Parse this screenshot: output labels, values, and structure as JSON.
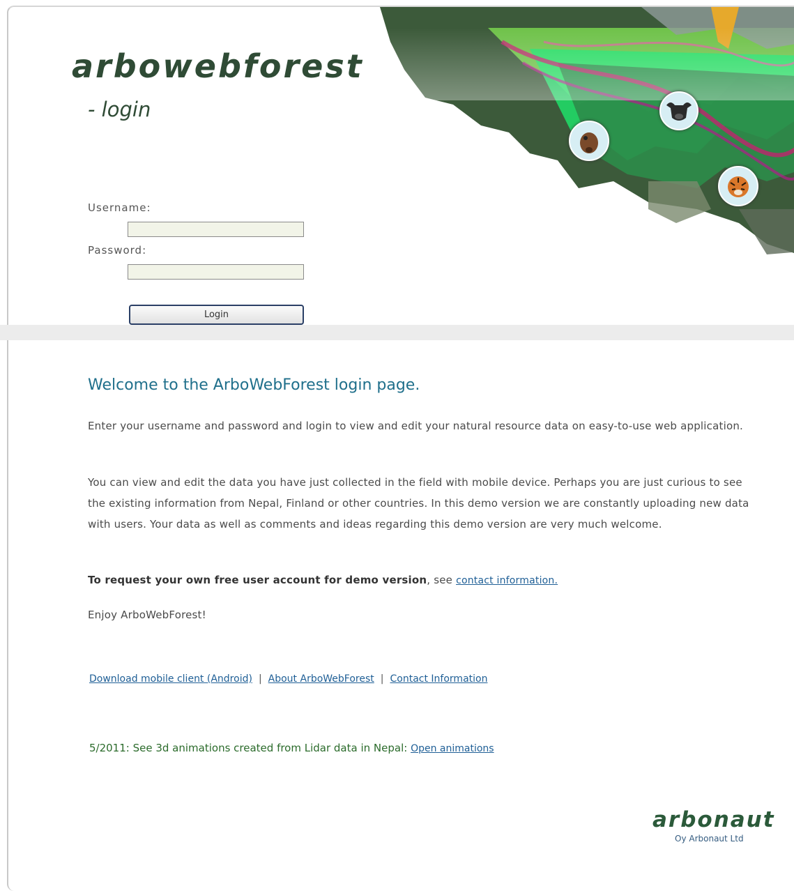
{
  "brand": {
    "logo": "arbowebforest",
    "subtitle": "- login"
  },
  "form": {
    "username_label": "Username:",
    "username_value": "",
    "password_label": "Password:",
    "password_value": "",
    "login_button": "Login"
  },
  "content": {
    "welcome_title": "Welcome to the ArboWebForest login page.",
    "paragraph1": "Enter your username and password and login to view and edit your natural resource data on easy-to-use web application.",
    "paragraph2": "You can view and edit the data you have just collected in the field with mobile device. Perhaps you are just curious to see the existing information from Nepal, Finland or other countries. In this demo version we are constantly uploading new data with users. Your data as well as comments and ideas regarding this demo version are very much welcome.",
    "request_bold": "To request your own free user account for demo version",
    "request_rest": ", see ",
    "request_link": "contact information.",
    "enjoy": "Enjoy ArboWebForest!"
  },
  "footer_links": {
    "download": "Download mobile client (Android)",
    "about": "About ArboWebForest",
    "contact": "Contact Information",
    "separator": "|"
  },
  "news": {
    "text": "5/2011: See 3d animations created from Lidar data in Nepal: ",
    "link": "Open animations"
  },
  "company": {
    "name": "arbonaut",
    "legal": "Oy Arbonaut Ltd"
  },
  "icons": [
    "deer-icon",
    "bull-icon",
    "tiger-icon"
  ],
  "colors": {
    "brand_green": "#2f4b35",
    "heading_blue": "#1f6f8b",
    "link_blue": "#1f5f96",
    "news_green": "#2b6b2b"
  }
}
